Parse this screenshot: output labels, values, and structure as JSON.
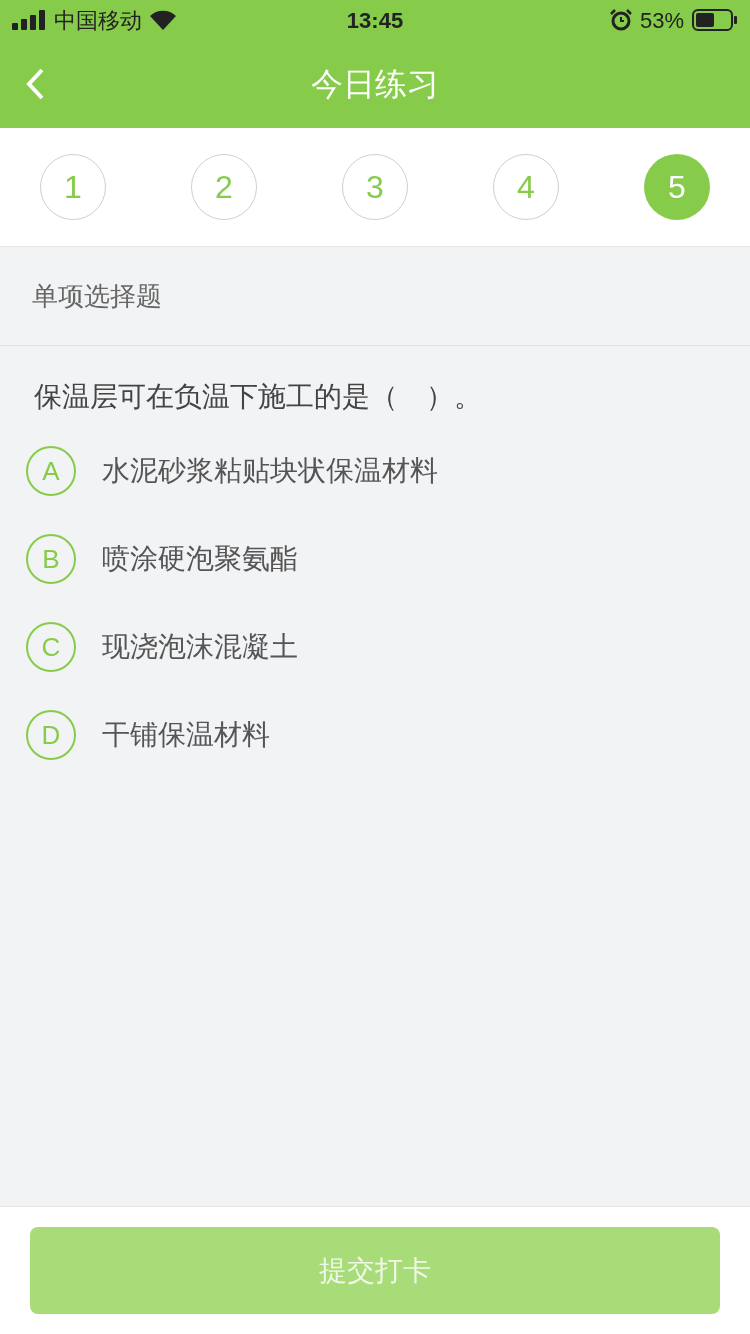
{
  "status_bar": {
    "carrier": "中国移动",
    "time": "13:45",
    "battery": "53%"
  },
  "header": {
    "title": "今日练习"
  },
  "question_tabs": [
    {
      "label": "1",
      "selected": false
    },
    {
      "label": "2",
      "selected": false
    },
    {
      "label": "3",
      "selected": false
    },
    {
      "label": "4",
      "selected": false
    },
    {
      "label": "5",
      "selected": true
    }
  ],
  "section_title": "单项选择题",
  "question": "保温层可在负温下施工的是（　）。",
  "options": [
    {
      "letter": "A",
      "text": "水泥砂浆粘贴块状保温材料",
      "selected": false
    },
    {
      "letter": "B",
      "text": "喷涂硬泡聚氨酯",
      "selected": false
    },
    {
      "letter": "C",
      "text": "现浇泡沫混凝土",
      "selected": false
    },
    {
      "letter": "D",
      "text": "干铺保温材料",
      "selected": false
    }
  ],
  "submit_button": {
    "label": "提交打卡",
    "disabled": true
  }
}
